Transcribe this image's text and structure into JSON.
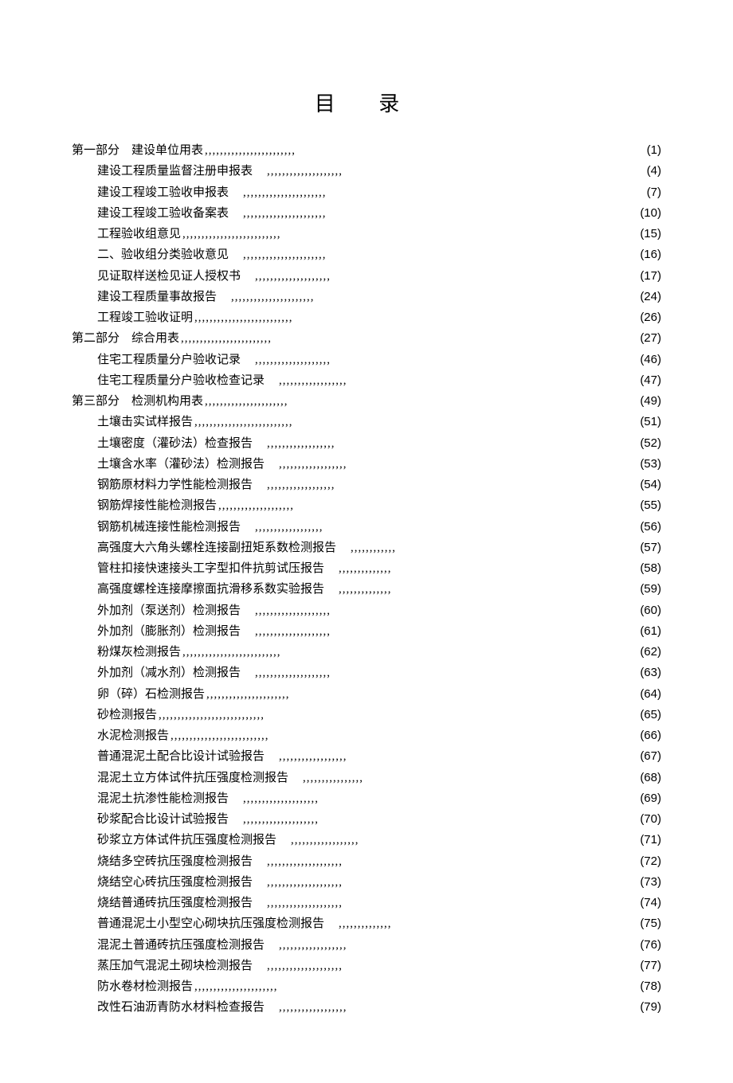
{
  "title": "目 录",
  "entries": [
    {
      "level": 0,
      "label": "第一部分　建设单位用表",
      "dots": ",,,,,,,,,,,,,,,,,,,,,,,,",
      "page": "(1)"
    },
    {
      "level": 1,
      "label": "建设工程质量监督注册申报表",
      "dots": "　,,,,,,,,,,,,,,,,,,,,",
      "page": "(4)"
    },
    {
      "level": 1,
      "label": "建设工程竣工验收申报表",
      "dots": "　,,,,,,,,,,,,,,,,,,,,,,",
      "page": "(7)"
    },
    {
      "level": 1,
      "label": "建设工程竣工验收备案表",
      "dots": "　,,,,,,,,,,,,,,,,,,,,,,",
      "page": "(10)"
    },
    {
      "level": 1,
      "label": "工程验收组意见",
      "dots": ",,,,,,,,,,,,,,,,,,,,,,,,,,",
      "page": "(15)"
    },
    {
      "level": 1,
      "label": "二、验收组分类验收意见",
      "dots": "　,,,,,,,,,,,,,,,,,,,,,,",
      "page": "(16)"
    },
    {
      "level": 1,
      "label": "见证取样送检见证人授权书",
      "dots": "　,,,,,,,,,,,,,,,,,,,,",
      "page": "(17)"
    },
    {
      "level": 1,
      "label": "建设工程质量事故报告",
      "dots": "　,,,,,,,,,,,,,,,,,,,,,,",
      "page": "(24)"
    },
    {
      "level": 1,
      "label": "工程竣工验收证明",
      "dots": ",,,,,,,,,,,,,,,,,,,,,,,,,,",
      "page": "(26)"
    },
    {
      "level": 0,
      "label": "第二部分　综合用表",
      "dots": ",,,,,,,,,,,,,,,,,,,,,,,,",
      "page": "(27)"
    },
    {
      "level": 1,
      "label": "住宅工程质量分户验收记录",
      "dots": "　,,,,,,,,,,,,,,,,,,,,",
      "page": "(46)"
    },
    {
      "level": 1,
      "label": "住宅工程质量分户验收检查记录",
      "dots": "　,,,,,,,,,,,,,,,,,,",
      "page": "(47)"
    },
    {
      "level": 0,
      "label": "第三部分　检测机构用表",
      "dots": ",,,,,,,,,,,,,,,,,,,,,,",
      "page": "(49)"
    },
    {
      "level": 1,
      "label": "土壤击实试样报告",
      "dots": ",,,,,,,,,,,,,,,,,,,,,,,,,,",
      "page": "(51)"
    },
    {
      "level": 1,
      "label": "土壤密度（灌砂法）检查报告",
      "dots": "　,,,,,,,,,,,,,,,,,,",
      "page": "(52)"
    },
    {
      "level": 1,
      "label": "土壤含水率（灌砂法）检测报告",
      "dots": "　,,,,,,,,,,,,,,,,,,",
      "page": "(53)"
    },
    {
      "level": 1,
      "label": "钢筋原材料力学性能检测报告",
      "dots": "　,,,,,,,,,,,,,,,,,,",
      "page": "(54)"
    },
    {
      "level": 1,
      "label": "钢筋焊接性能检测报告",
      "dots": ",,,,,,,,,,,,,,,,,,,,",
      "page": "(55)"
    },
    {
      "level": 1,
      "label": "钢筋机械连接性能检测报告",
      "dots": "　,,,,,,,,,,,,,,,,,,",
      "page": "(56)"
    },
    {
      "level": 1,
      "label": "高强度大六角头螺栓连接副扭矩系数检测报告",
      "dots": "　,,,,,,,,,,,,",
      "page": "(57)"
    },
    {
      "level": 1,
      "label": "管柱扣接快速接头工字型扣件抗剪试压报告",
      "dots": "　,,,,,,,,,,,,,,",
      "page": "(58)"
    },
    {
      "level": 1,
      "label": "高强度螺栓连接摩擦面抗滑移系数实验报告",
      "dots": "　,,,,,,,,,,,,,,",
      "page": "(59)"
    },
    {
      "level": 1,
      "label": "外加剂（泵送剂）检测报告",
      "dots": "　,,,,,,,,,,,,,,,,,,,,",
      "page": "(60)"
    },
    {
      "level": 1,
      "label": "外加剂（膨胀剂）检测报告",
      "dots": "　,,,,,,,,,,,,,,,,,,,,",
      "page": "(61)"
    },
    {
      "level": 1,
      "label": "粉煤灰检测报告",
      "dots": ",,,,,,,,,,,,,,,,,,,,,,,,,,",
      "page": "(62)"
    },
    {
      "level": 1,
      "label": "外加剂（减水剂）检测报告",
      "dots": "　,,,,,,,,,,,,,,,,,,,,",
      "page": "(63)"
    },
    {
      "level": 1,
      "label": "卵（碎）石检测报告",
      "dots": ",,,,,,,,,,,,,,,,,,,,,,",
      "page": "(64)"
    },
    {
      "level": 1,
      "label": "砂检测报告",
      "dots": ",,,,,,,,,,,,,,,,,,,,,,,,,,,,",
      "page": "(65)"
    },
    {
      "level": 1,
      "label": "水泥检测报告",
      "dots": ",,,,,,,,,,,,,,,,,,,,,,,,,,",
      "page": "(66)"
    },
    {
      "level": 1,
      "label": "普通混泥土配合比设计试验报告",
      "dots": "　,,,,,,,,,,,,,,,,,,",
      "page": "(67)"
    },
    {
      "level": 1,
      "label": "混泥土立方体试件抗压强度检测报告",
      "dots": "　,,,,,,,,,,,,,,,,",
      "page": "(68)"
    },
    {
      "level": 1,
      "label": "混泥土抗渗性能检测报告",
      "dots": "　,,,,,,,,,,,,,,,,,,,,",
      "page": "(69)"
    },
    {
      "level": 1,
      "label": "砂浆配合比设计试验报告",
      "dots": "　,,,,,,,,,,,,,,,,,,,,",
      "page": "(70)"
    },
    {
      "level": 1,
      "label": "砂浆立方体试件抗压强度检测报告",
      "dots": "　,,,,,,,,,,,,,,,,,,",
      "page": "(71)"
    },
    {
      "level": 1,
      "label": "烧结多空砖抗压强度检测报告",
      "dots": "　,,,,,,,,,,,,,,,,,,,,",
      "page": "(72)"
    },
    {
      "level": 1,
      "label": "烧结空心砖抗压强度检测报告",
      "dots": "　,,,,,,,,,,,,,,,,,,,,",
      "page": "(73)"
    },
    {
      "level": 1,
      "label": "烧结普通砖抗压强度检测报告",
      "dots": "　,,,,,,,,,,,,,,,,,,,,",
      "page": "(74)"
    },
    {
      "level": 1,
      "label": "普通混泥土小型空心砌块抗压强度检测报告",
      "dots": "　,,,,,,,,,,,,,,",
      "page": "(75)"
    },
    {
      "level": 1,
      "label": "混泥土普通砖抗压强度检测报告",
      "dots": "　,,,,,,,,,,,,,,,,,,",
      "page": "(76)"
    },
    {
      "level": 1,
      "label": "蒸压加气混泥土砌块检测报告",
      "dots": "　,,,,,,,,,,,,,,,,,,,,",
      "page": "(77)"
    },
    {
      "level": 1,
      "label": "防水卷材检测报告",
      "dots": ",,,,,,,,,,,,,,,,,,,,,,",
      "page": "(78)"
    },
    {
      "level": 1,
      "label": "改性石油沥青防水材料检查报告",
      "dots": "　,,,,,,,,,,,,,,,,,,",
      "page": "(79)"
    }
  ]
}
